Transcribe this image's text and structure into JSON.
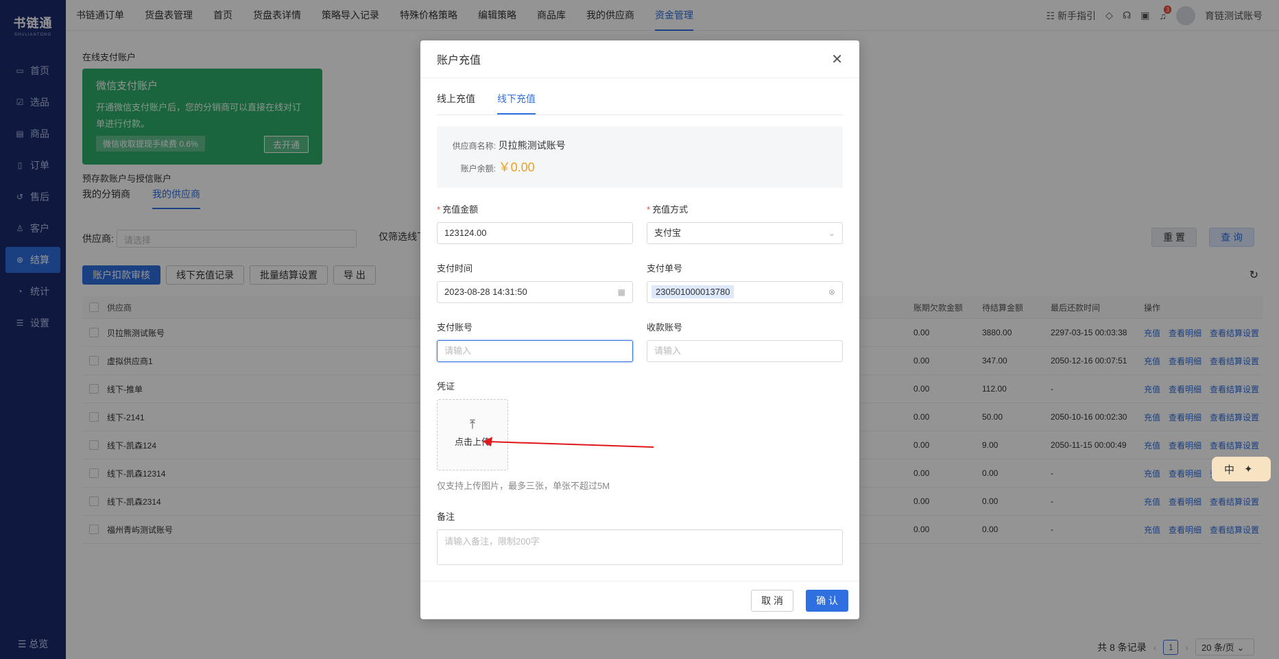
{
  "sidebar": {
    "logo": "书链通",
    "logo_sub": "SHULIANTONG",
    "items": [
      {
        "label": "首页",
        "icon": "monitor-icon"
      },
      {
        "label": "选品",
        "icon": "check-square-icon"
      },
      {
        "label": "商品",
        "icon": "box-icon"
      },
      {
        "label": "订单",
        "icon": "file-icon"
      },
      {
        "label": "售后",
        "icon": "headset-icon"
      },
      {
        "label": "客户",
        "icon": "users-icon"
      },
      {
        "label": "结算",
        "icon": "settle-icon"
      },
      {
        "label": "统计",
        "icon": "pie-icon"
      },
      {
        "label": "设置",
        "icon": "sliders-icon"
      }
    ],
    "active_index": 6,
    "bottom": "总览"
  },
  "topnav": {
    "items": [
      "书链通订单",
      "货盘表管理",
      "首页",
      "货盘表详情",
      "策略导入记录",
      "特殊价格策略",
      "编辑策略",
      "商品库",
      "我的供应商",
      "资金管理"
    ],
    "active_index": 9,
    "guide": "新手指引",
    "notify_count": "3",
    "user": "育链测试账号"
  },
  "page": {
    "online_title": "在线支付账户",
    "wx_title": "微信支付账户",
    "wx_desc": "开通微信支付账户后，您的分销商可以直接在线对订单进行付款。",
    "wx_fee": "微信收取提现手续费 0.6%",
    "wx_open": "去开通",
    "prepay_title": "预存款账户与授信账户",
    "tabs": [
      "我的分销商",
      "我的供应商"
    ],
    "supplier_label": "供应商:",
    "supplier_placeholder": "请选择",
    "filter_only": "仅筛选线下",
    "reset": "重 置",
    "query": "查 询",
    "buttons": [
      "账户扣款审核",
      "线下充值记录",
      "批量结算设置",
      "导 出"
    ],
    "columns": {
      "name": "供应商",
      "a": "账期欠款金额",
      "b": "待结算金额",
      "c": "最后还款时间",
      "d": "操作"
    },
    "rows": [
      {
        "name": "贝拉熊测试账号",
        "a": "0.00",
        "b": "3880.00",
        "c": "2297-03-15 00:03:38"
      },
      {
        "name": "虚拟供应商1",
        "a": "0.00",
        "b": "347.00",
        "c": "2050-12-16 00:07:51"
      },
      {
        "name": "线下-推单",
        "a": "0.00",
        "b": "112.00",
        "c": "-"
      },
      {
        "name": "线下-2141",
        "a": "0.00",
        "b": "50.00",
        "c": "2050-10-16 00:02:30"
      },
      {
        "name": "线下-凯森124",
        "a": "0.00",
        "b": "9.00",
        "c": "2050-11-15 00:00:49"
      },
      {
        "name": "线下-凯森12314",
        "a": "0.00",
        "b": "0.00",
        "c": "-"
      },
      {
        "name": "线下-凯森2314",
        "a": "0.00",
        "b": "0.00",
        "c": "-"
      },
      {
        "name": "福州青屿测试账号",
        "a": "0.00",
        "b": "0.00",
        "c": "-"
      }
    ],
    "row_actions": [
      "充值",
      "查看明细",
      "查看结算设置"
    ],
    "total": "共 8 条记录",
    "page_num": "1",
    "page_size": "20 条/页"
  },
  "modal": {
    "title": "账户充值",
    "tabs": [
      "线上充值",
      "线下充值"
    ],
    "active_tab": 1,
    "supplier_label": "供应商名称:",
    "supplier_value": "贝拉熊测试账号",
    "balance_label": "账户余额:",
    "balance_value": "￥0.00",
    "amount_label": "充值金额",
    "amount_value": "123124.00",
    "method_label": "充值方式",
    "method_value": "支付宝",
    "time_label": "支付时间",
    "time_value": "2023-08-28 14:31:50",
    "order_label": "支付单号",
    "order_value": "230501000013780",
    "pay_account_label": "支付账号",
    "pay_account_placeholder": "请输入",
    "recv_account_label": "收款账号",
    "recv_account_placeholder": "请输入",
    "voucher_label": "凭证",
    "upload_text": "点击上传",
    "upload_hint": "仅支持上传图片，最多三张，单张不超过5M",
    "remark_label": "备注",
    "remark_placeholder": "请输入备注，限制200字",
    "cancel": "取 消",
    "ok": "确 认"
  },
  "ime": {
    "label": "中"
  },
  "colors": {
    "primary": "#2f6fe0",
    "sidebar": "#1a2a6c",
    "wechat": "#2fae6c",
    "balance": "#f0a020",
    "annotation": "#e0161b"
  }
}
